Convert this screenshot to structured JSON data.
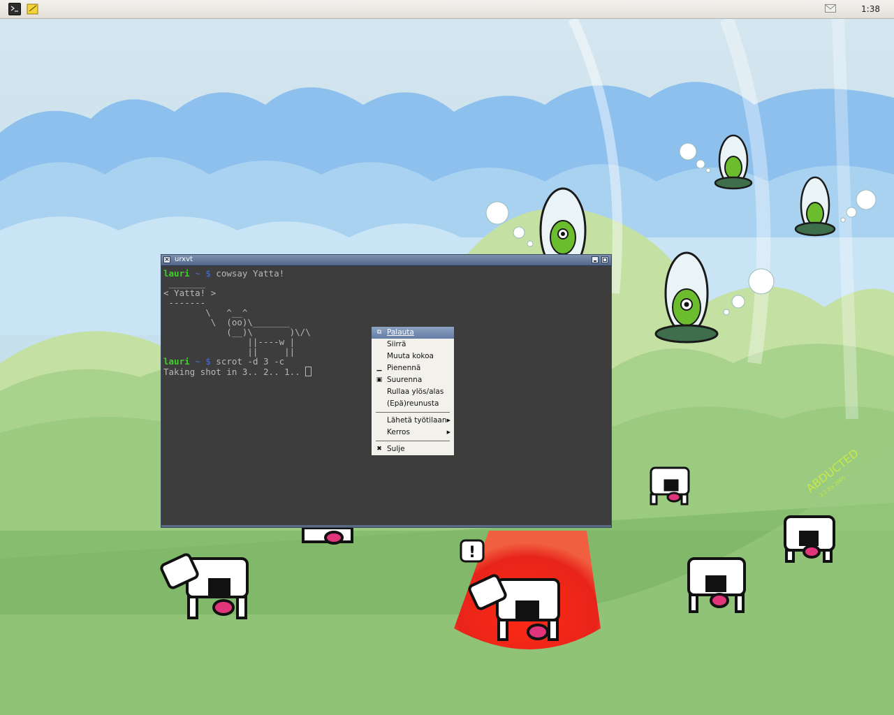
{
  "panel": {
    "launchers": [
      {
        "name": "terminal-icon"
      },
      {
        "name": "notes-icon"
      }
    ],
    "tray": {
      "mail_icon": "mail-icon"
    },
    "clock": "1:38"
  },
  "terminal": {
    "title": "urxvt",
    "close_glyph": "×",
    "lines": [
      {
        "user": "lauri",
        "dir": "~",
        "symbol": "$",
        "command": "cowsay Yatta!"
      },
      {
        "text": " _______"
      },
      {
        "text": "< Yatta! >"
      },
      {
        "text": " -------"
      },
      {
        "text": "        \\   ^__^"
      },
      {
        "text": "         \\  (oo)\\_______"
      },
      {
        "text": "            (__)\\       )\\/\\"
      },
      {
        "text": "                ||----w |"
      },
      {
        "text": "                ||     ||"
      },
      {
        "user": "lauri",
        "dir": "~",
        "symbol": "$",
        "command": "scrot -d 3 -c"
      },
      {
        "text": "Taking shot in 3.. 2.. 1.. "
      }
    ]
  },
  "context_menu": {
    "items": [
      {
        "label": "Palauta",
        "icon": "restore-icon",
        "glyph": "⧉"
      },
      {
        "label": "Siirrä"
      },
      {
        "label": "Muuta kokoa"
      },
      {
        "label": "Pienennä",
        "icon": "minimize-icon",
        "glyph": "▁"
      },
      {
        "label": "Suurenna",
        "icon": "maximize-icon",
        "glyph": "▣"
      },
      {
        "label": "Rullaa ylös/alas"
      },
      {
        "label": "(Epä)reunusta"
      },
      {
        "label": "Lähetä työtilaan",
        "submenu": true
      },
      {
        "label": "Kerros",
        "submenu": true
      },
      {
        "label": "Sulje",
        "icon": "close-icon",
        "glyph": "✖"
      }
    ],
    "submenu_glyph": "▶"
  },
  "wallpaper": {
    "text": "ABDUCTED",
    "subtext": "2.1.2ix 2005",
    "speech_glyph": "!",
    "colors": {
      "sky": "#9fcbec",
      "hill_light": "#b9d99a",
      "hill_dark": "#7fb865",
      "beam": "#e8241a",
      "alien": "#6cbd2d"
    }
  }
}
